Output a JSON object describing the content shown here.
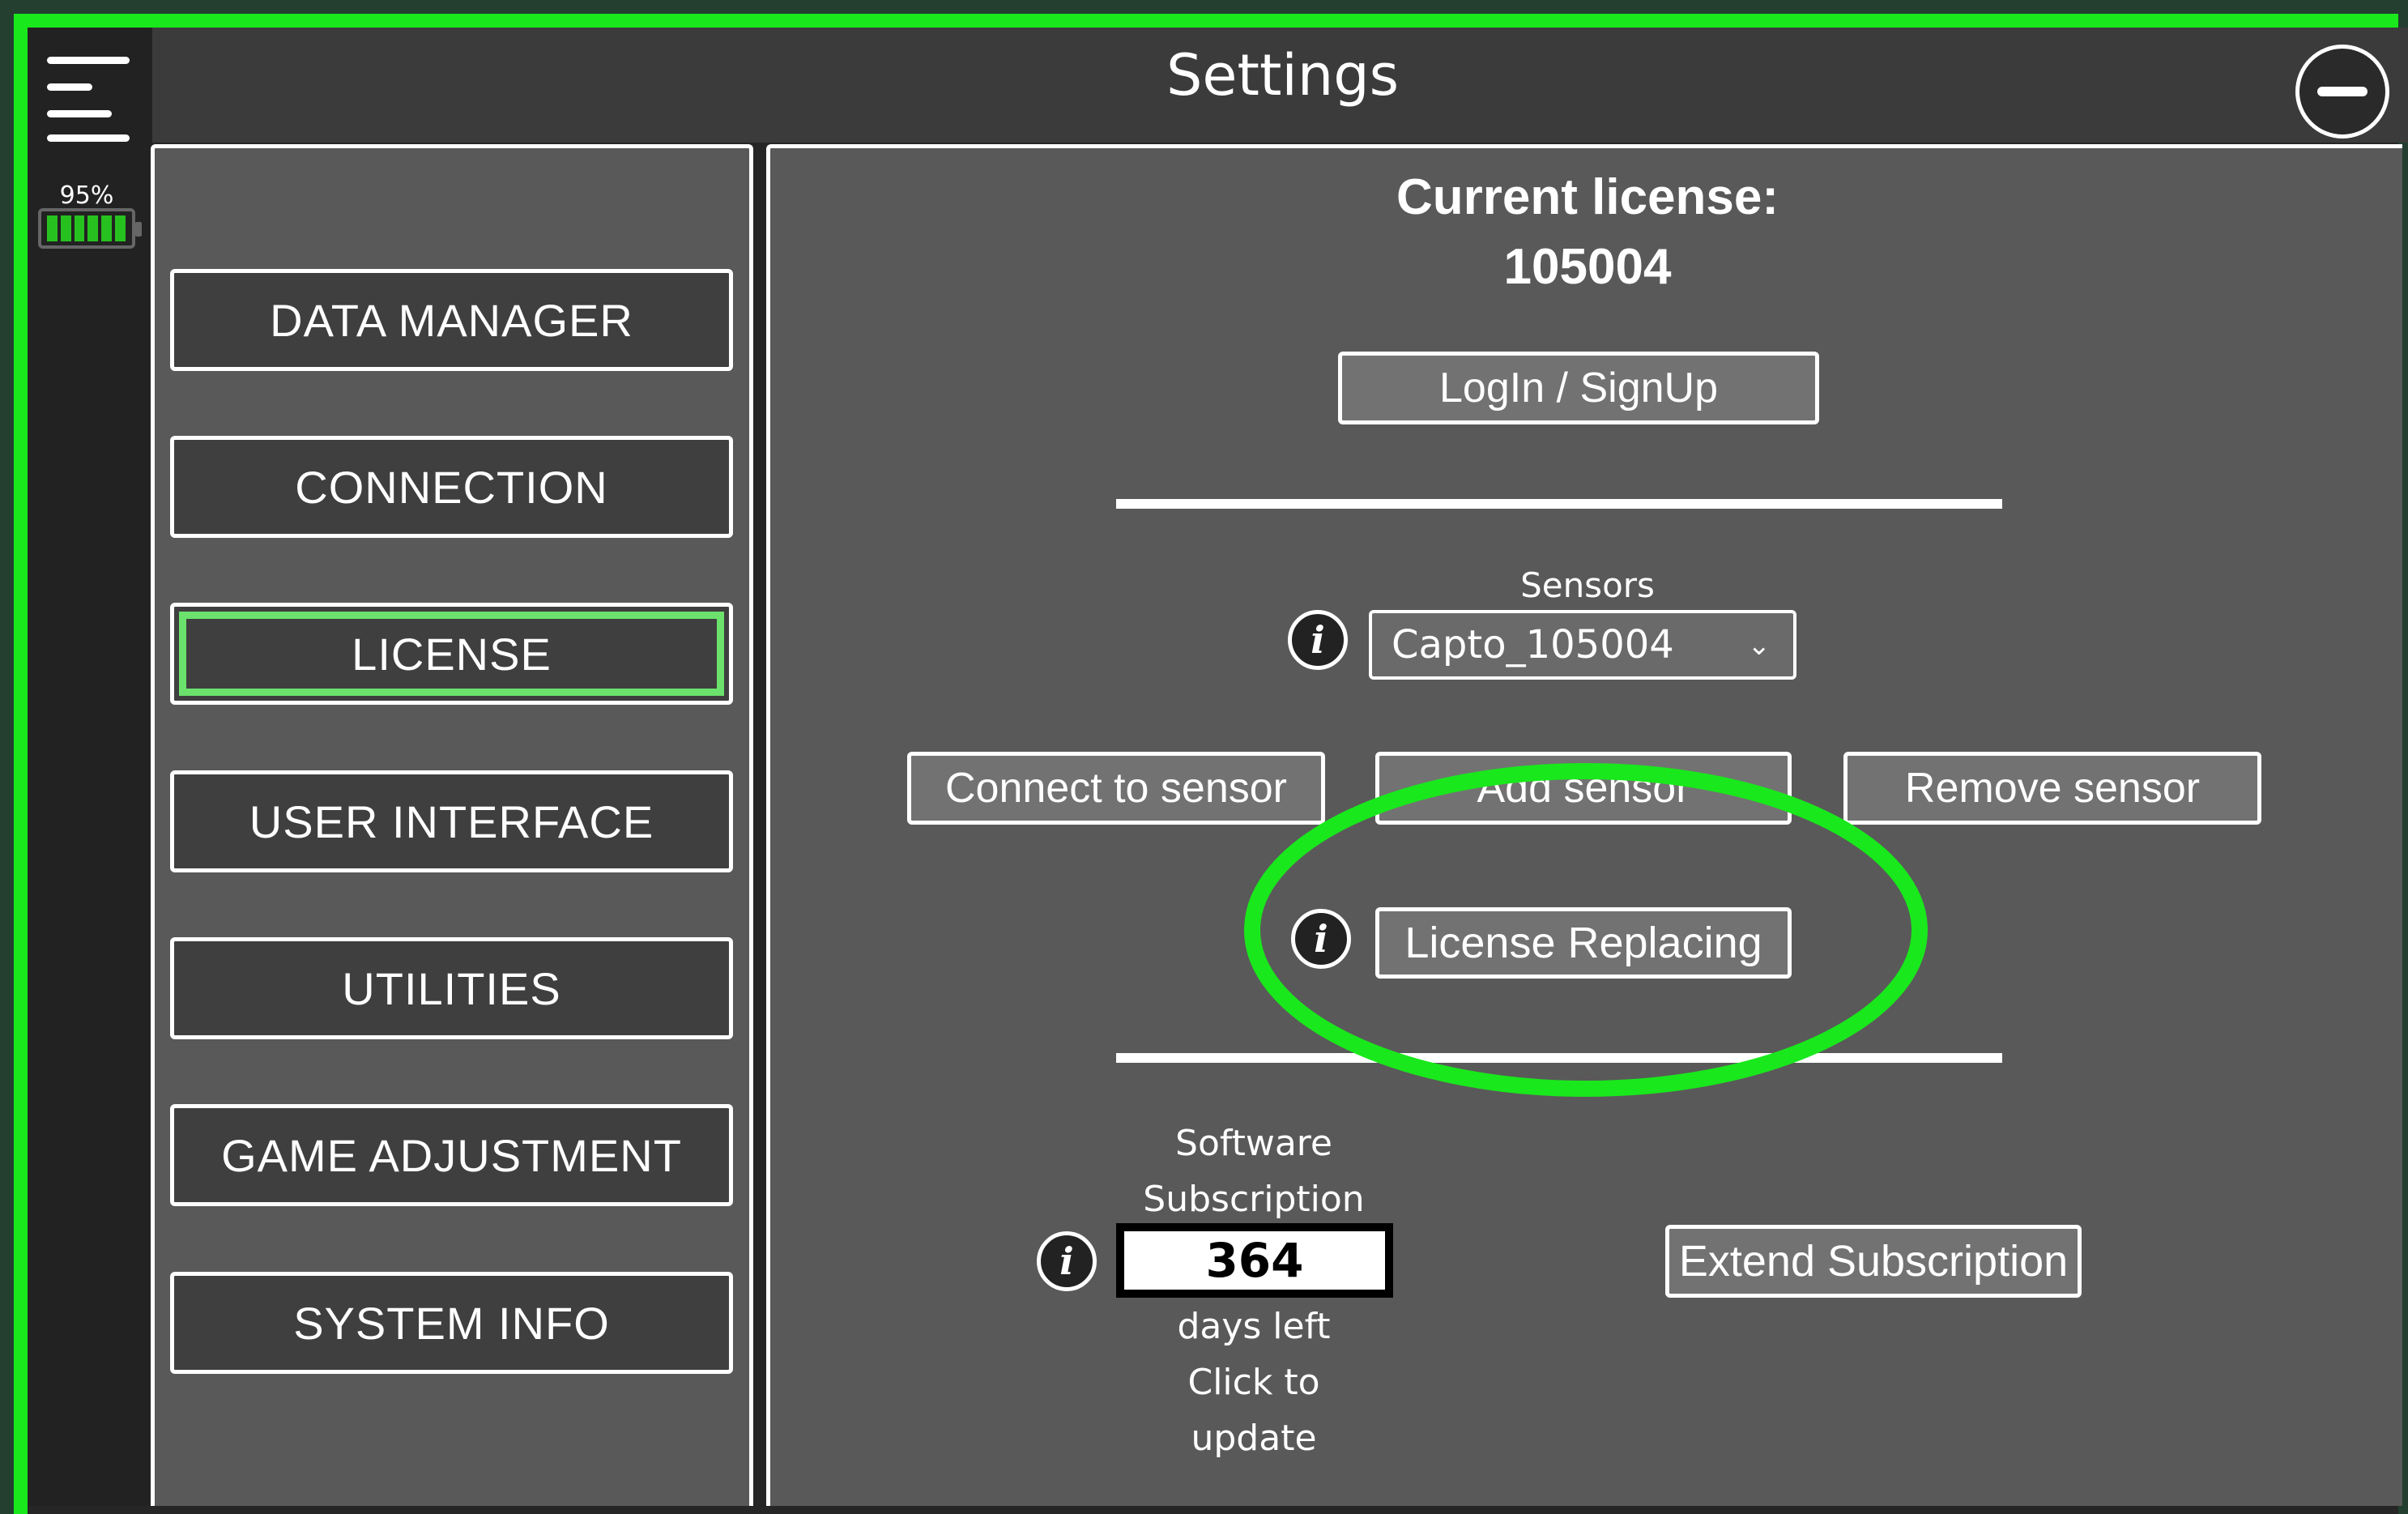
{
  "header": {
    "title": "Settings"
  },
  "status": {
    "battery_percent": "95%"
  },
  "colors": {
    "accent": "#19e81c",
    "active_nav": "#6be26c",
    "panel": "#595959"
  },
  "sidebar": {
    "items": [
      {
        "label": "DATA MANAGER",
        "active": false
      },
      {
        "label": "CONNECTION",
        "active": false
      },
      {
        "label": "LICENSE",
        "active": true
      },
      {
        "label": "USER INTERFACE",
        "active": false
      },
      {
        "label": "UTILITIES",
        "active": false
      },
      {
        "label": "GAME ADJUSTMENT",
        "active": false
      },
      {
        "label": "SYSTEM INFO",
        "active": false
      }
    ]
  },
  "license": {
    "title": "Current license:",
    "number": "105004",
    "login_button": "LogIn / SignUp",
    "sensors_label": "Sensors",
    "sensor_selected": "Capto_105004",
    "connect_button": "Connect to sensor",
    "add_button": "Add sensor",
    "remove_button": "Remove sensor",
    "replace_button": "License Replacing",
    "subscription_label_1": "Software",
    "subscription_label_2": "Subscription",
    "days_value": "364",
    "days_left": "days left",
    "click_1": "Click to",
    "click_2": "update",
    "extend_button": "Extend Subscription"
  }
}
